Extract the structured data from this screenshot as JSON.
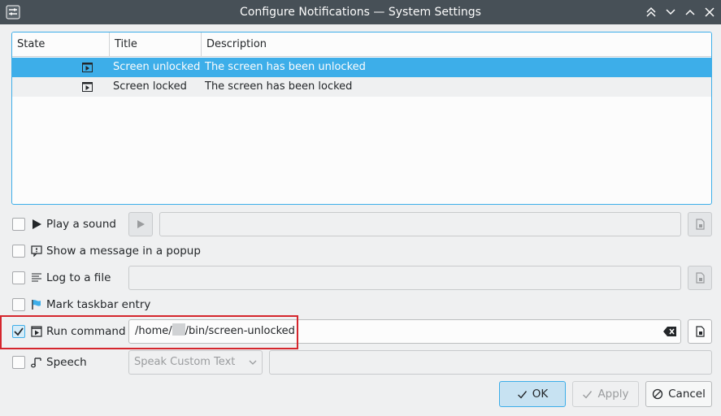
{
  "window": {
    "title": "Configure Notifications — System Settings"
  },
  "table": {
    "headers": [
      "State",
      "Title",
      "Description"
    ],
    "rows": [
      {
        "title": "Screen unlocked",
        "description": "The screen has been unlocked",
        "selected": true
      },
      {
        "title": "Screen locked",
        "description": "The screen has been locked",
        "selected": false
      }
    ]
  },
  "options": {
    "play_sound": {
      "label": "Play a sound",
      "checked": false
    },
    "popup": {
      "label": "Show a message in a popup",
      "checked": false
    },
    "log_file": {
      "label": "Log to a file",
      "checked": false
    },
    "taskbar": {
      "label": "Mark taskbar entry",
      "checked": false
    },
    "run_command": {
      "label": "Run command",
      "checked": true,
      "value_prefix": "/home/",
      "value_suffix": "/bin/screen-unlocked"
    },
    "speech": {
      "label": "Speech",
      "checked": false,
      "select_value": "Speak Custom Text"
    }
  },
  "buttons": {
    "ok": "OK",
    "apply": "Apply",
    "cancel": "Cancel"
  },
  "colors": {
    "accent": "#3daee9",
    "titlebar": "#475057",
    "highlight": "#d5262d"
  }
}
